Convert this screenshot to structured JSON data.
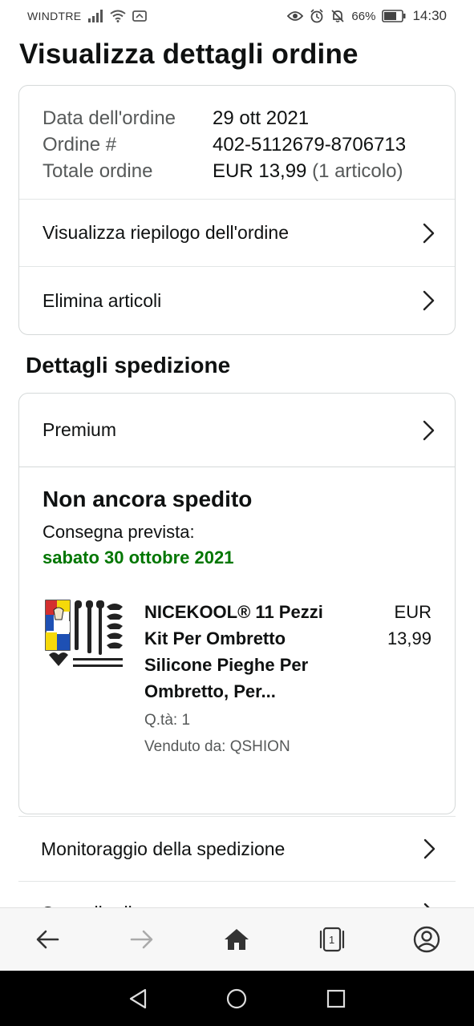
{
  "status_bar": {
    "carrier": "WINDTRE",
    "battery": "66%",
    "time": "14:30"
  },
  "page": {
    "title": "Visualizza dettagli ordine"
  },
  "order": {
    "date_label": "Data dell'ordine",
    "date_value": "29 ott 2021",
    "number_label": "Ordine #",
    "number_value": "402-5112679-8706713",
    "total_label": "Totale ordine",
    "total_value": "EUR 13,99",
    "total_items": "(1 articolo)",
    "summary_link": "Visualizza riepilogo dell'ordine",
    "delete_link": "Elimina articoli"
  },
  "shipping": {
    "section_title": "Dettagli spedizione",
    "method": "Premium",
    "status": "Non ancora spedito",
    "delivery_label": "Consegna prevista:",
    "delivery_date": "sabato 30 ottobre 2021",
    "product": {
      "title": "NICEKOOL® 11 Pezzi Kit Per Ombretto Silicone Pieghe Per Ombretto, Per...",
      "qty": "Q.tà: 1",
      "seller": "Venduto da: QSHION",
      "price_currency": "EUR",
      "price_amount": "13,99"
    },
    "tracking_link": "Monitoraggio della spedizione",
    "next_link_partial": "Cancella di..."
  },
  "browser_nav": {
    "tab_count": "1"
  },
  "colors": {
    "accent_green": "#007600",
    "border": "#d5d9d9",
    "muted_text": "#565959"
  }
}
